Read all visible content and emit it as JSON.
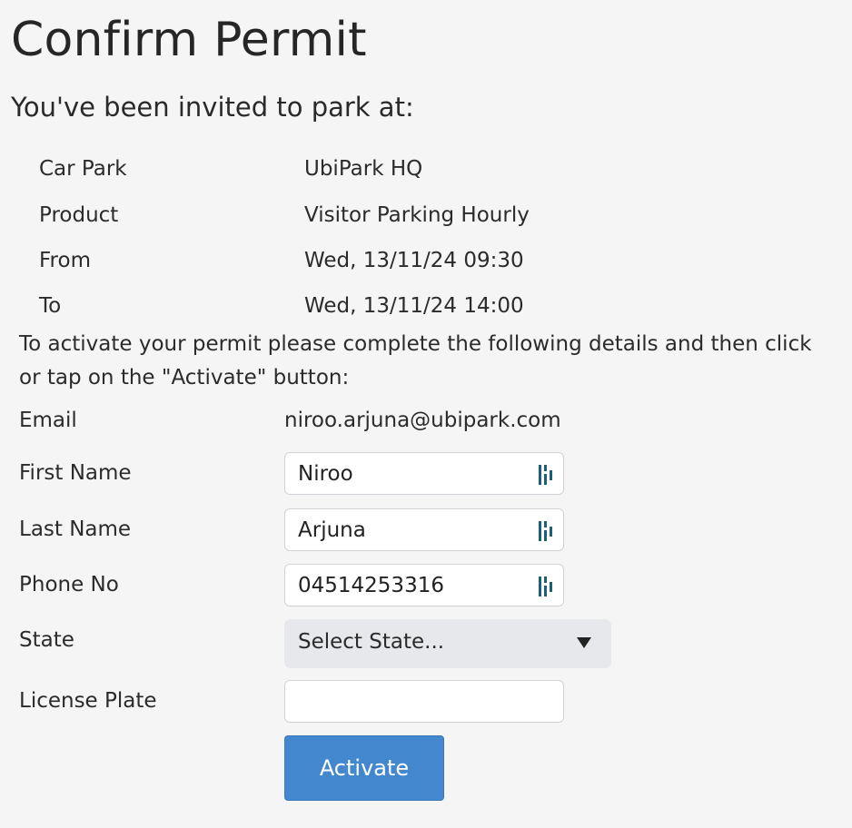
{
  "title": "Confirm Permit",
  "subtitle": "You've been invited to park at:",
  "details": [
    {
      "label": "Car Park",
      "value": "UbiPark HQ"
    },
    {
      "label": "Product",
      "value": "Visitor Parking Hourly"
    },
    {
      "label": "From",
      "value": "Wed, 13/11/24 09:30"
    },
    {
      "label": "To",
      "value": "Wed, 13/11/24 14:00"
    }
  ],
  "instructions": "To activate your permit please complete the following details and then click or tap on the \"Activate\" button:",
  "form": {
    "email": {
      "label": "Email",
      "value": "niroo.arjuna@ubipark.com"
    },
    "first_name": {
      "label": "First Name",
      "value": "Niroo"
    },
    "last_name": {
      "label": "Last Name",
      "value": "Arjuna"
    },
    "phone": {
      "label": "Phone No",
      "value": "04514253316"
    },
    "state": {
      "label": "State",
      "selected": "Select State..."
    },
    "license_plate": {
      "label": "License Plate",
      "value": ""
    }
  },
  "activate_label": "Activate",
  "icons": {
    "autofill": "password-manager-icon"
  },
  "colors": {
    "accent": "#4388cf",
    "icon": "#1d5f74"
  }
}
